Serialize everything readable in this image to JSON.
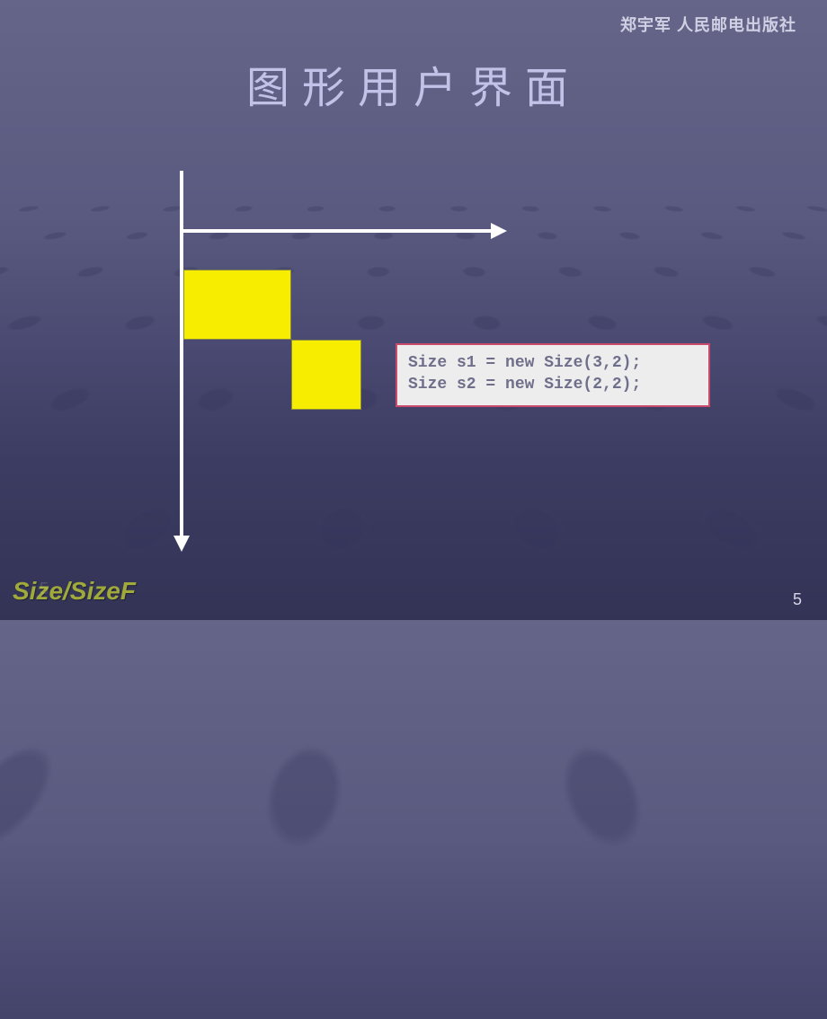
{
  "header": {
    "author_publisher": "郑宇军  人民邮电出版社"
  },
  "title": "图形用户界面",
  "code": {
    "line1": "Size s1 = new Size(3,2);",
    "line2": "Size s2 = new Size(2,2);"
  },
  "footer": {
    "topic": "Size/SizeF",
    "page_number": "5",
    "page_number_shadow": "5"
  }
}
